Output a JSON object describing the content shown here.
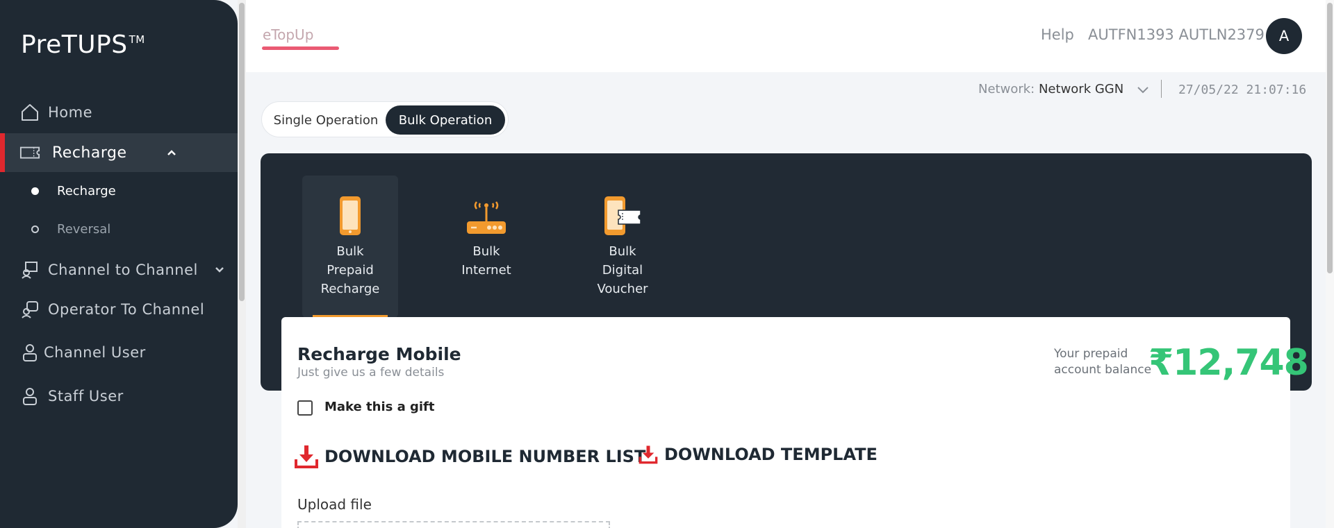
{
  "sidebar": {
    "logo": "PreTUPS",
    "logo_tm": "TM",
    "items": [
      {
        "label": "Home",
        "icon": "home-icon"
      },
      {
        "label": "Recharge",
        "icon": "recharge-icon"
      },
      {
        "label": "Channel to Channel",
        "icon": "channel-to-channel-icon"
      },
      {
        "label": "Operator To Channel",
        "icon": "operator-to-channel-icon"
      },
      {
        "label": "Channel User",
        "icon": "user-icon"
      },
      {
        "label": "Staff User",
        "icon": "user-icon"
      }
    ],
    "subitems": [
      {
        "label": "Recharge"
      },
      {
        "label": "Reversal"
      }
    ]
  },
  "header": {
    "app_tab": "eTopUp",
    "help": "Help",
    "user_name": "AUTFN1393 AUTLN2379",
    "avatar_initial": "A"
  },
  "network": {
    "label": "Network:",
    "value": "Network GGN",
    "datetime": "27/05/22 21:07:16"
  },
  "operation_toggle": {
    "single": "Single Operation",
    "bulk": "Bulk Operation",
    "selected": "bulk"
  },
  "services": [
    {
      "label_lines": [
        "Bulk",
        "Prepaid",
        "Recharge"
      ],
      "icon": "mobile-phone-icon"
    },
    {
      "label_lines": [
        "Bulk",
        "Internet"
      ],
      "icon": "wifi-router-icon"
    },
    {
      "label_lines": [
        "Bulk",
        "Digital",
        "Voucher"
      ],
      "icon": "digital-voucher-icon"
    }
  ],
  "card": {
    "title": "Recharge Mobile",
    "subtitle": "Just give us a few details",
    "balance_label": "Your prepaid account balance",
    "balance_value": "₹12,748",
    "gift_label": "Make this a gift",
    "download_list": "DOWNLOAD MOBILE NUMBER LIST",
    "download_template": "DOWNLOAD TEMPLATE",
    "upload_label": "Upload file"
  },
  "colors": {
    "sidebar_bg": "#1f2933",
    "active_accent": "#e0282e",
    "balance_green": "#35c577",
    "service_orange": "#f29a2e",
    "download_red": "#e0282e"
  }
}
